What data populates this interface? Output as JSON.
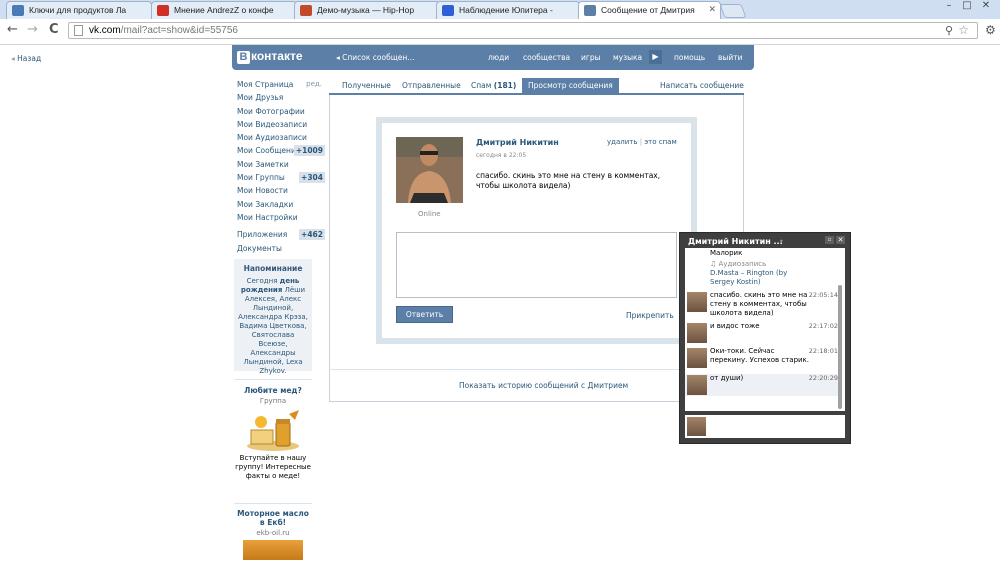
{
  "browser": {
    "tabs": [
      {
        "title": "Ключи для продуктов Ла",
        "icon": "vk-favicon-icon",
        "color": "#4a7ab7"
      },
      {
        "title": "Мнение AndrezZ о конфе",
        "icon": "youtube-icon",
        "color": "#d12f26"
      },
      {
        "title": "Демо-музыка — Hip-Hop",
        "icon": "music-app-icon",
        "color": "#c14a2a"
      },
      {
        "title": "Наблюдение Юпитера -",
        "icon": "arrow-favicon-icon",
        "color": "#2e5fd6"
      },
      {
        "title": "Сообщение от Дмитрия",
        "icon": "vk-favicon-icon",
        "color": "#5b7fa6"
      }
    ],
    "url_host": "vk.com",
    "url_rest": "/mail?act=show&id=55756",
    "back": "←",
    "forward": "→",
    "reload": "C",
    "win_min": "–",
    "win_max": "□",
    "win_close": "✕"
  },
  "page": {
    "back_link": "Назад",
    "header": {
      "logo_b": "В",
      "logo_text": "контакте",
      "back": "Список сообщен...",
      "nav": [
        "люди",
        "сообщества",
        "игры",
        "музыка",
        "помощь",
        "выйти"
      ]
    },
    "sidebar": {
      "items": [
        {
          "label": "Моя Страница",
          "extra": "ред."
        },
        {
          "label": "Мои Друзья"
        },
        {
          "label": "Мои Фотографии"
        },
        {
          "label": "Мои Видеозаписи"
        },
        {
          "label": "Мои Аудиозаписи"
        },
        {
          "label": "Мои Сообщения",
          "count": "+1009"
        },
        {
          "label": "Мои Заметки"
        },
        {
          "label": "Мои Группы",
          "count": "+304"
        },
        {
          "label": "Мои Новости"
        },
        {
          "label": "Мои Закладки"
        },
        {
          "label": "Мои Настройки"
        }
      ],
      "apps": {
        "label": "Приложения",
        "count": "+462"
      },
      "docs": "Документы"
    },
    "reminder": {
      "title": "Напоминание",
      "text_pre": "Сегодня ",
      "text_bold": "день рождения",
      "text_post": " Лёши Алексея, Алекс Лындиной, Александра Крэза, Вадима Цветкова, Святослава Всеюзе, Александры Лындиной, Lexa Zhykov."
    },
    "ad1": {
      "title": "Любите мед?",
      "sub": "Группа",
      "text": "Вступайте в нашу группу! Интересные факты о меде!"
    },
    "ad2": {
      "title": "Моторное масло в Екб!",
      "sub": "ekb-oil.ru"
    },
    "tabs": {
      "received": "Полученные",
      "sent": "Отправленные",
      "spam": "Спам",
      "spam_count": "(181)",
      "view": "Просмотр сообщения",
      "write": "Написать сообщение"
    },
    "message": {
      "sender": "Дмитрий Никитин",
      "time": "сегодня в 22:05",
      "delete": "удалить",
      "divider": "|",
      "spam": "это спам",
      "status": "Online",
      "text": "спасибо. скинь это мне на стену в комментах, чтобы школота видела)",
      "reply": "Ответить",
      "attach": "Прикрепить",
      "history": "Показать историю сообщений с Дмитрием"
    },
    "chat": {
      "title": "Дмитрий Никитин ...",
      "dot": "•",
      "min": "▫",
      "close": "✕",
      "top_name": "Малорик",
      "audio_label": "Аудиозапись",
      "audio_track": "D.Masta – Ringtоn (by Sergey Kostin)",
      "messages": [
        {
          "text": "спасибо. скинь это мне на стену в комментах, чтобы школота видела)",
          "time": "22:05:14"
        },
        {
          "text": "и видос тоже",
          "time": "22:17:02"
        },
        {
          "text": "Оки-токи. Сейчас перекину. Успехов старик.",
          "time": "22:18:01"
        },
        {
          "text": "от души)",
          "time": "22:20:29"
        }
      ]
    }
  }
}
